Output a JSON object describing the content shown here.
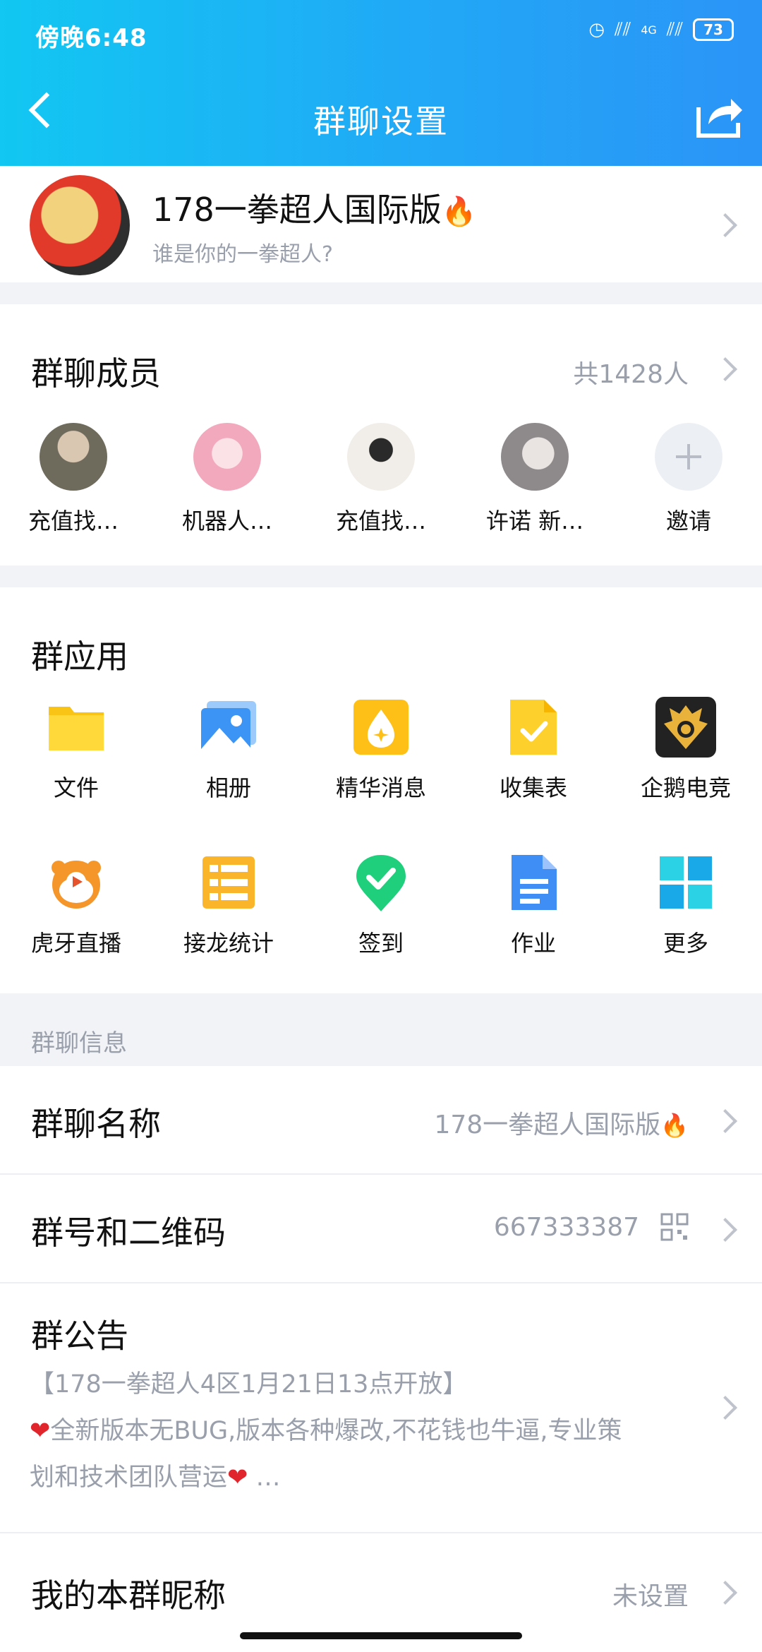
{
  "status_bar": {
    "time": "傍晚6:48",
    "network": "4G",
    "battery": "73"
  },
  "header": {
    "title": "群聊设置"
  },
  "group": {
    "name": "178一拳超人国际版",
    "name_emoji": "🔥",
    "description": "谁是你的一拳超人?"
  },
  "members": {
    "title": "群聊成员",
    "count": "共1428人",
    "items": [
      {
        "name": "充值找…"
      },
      {
        "name": "机器人…"
      },
      {
        "name": "充值找…"
      },
      {
        "name": "许诺 新…"
      },
      {
        "name": "邀请"
      }
    ]
  },
  "apps": {
    "title": "群应用",
    "items": [
      {
        "label": "文件",
        "icon": "folder-icon"
      },
      {
        "label": "相册",
        "icon": "photo-album-icon"
      },
      {
        "label": "精华消息",
        "icon": "essence-icon"
      },
      {
        "label": "收集表",
        "icon": "form-icon"
      },
      {
        "label": "企鹅电竞",
        "icon": "esports-icon"
      },
      {
        "label": "虎牙直播",
        "icon": "huya-icon"
      },
      {
        "label": "接龙统计",
        "icon": "relay-icon"
      },
      {
        "label": "签到",
        "icon": "checkin-icon"
      },
      {
        "label": "作业",
        "icon": "homework-icon"
      },
      {
        "label": "更多",
        "icon": "more-grid-icon"
      }
    ]
  },
  "info": {
    "section_label": "群聊信息",
    "group_name_label": "群聊名称",
    "group_name_value": "178一拳超人国际版",
    "group_id_label": "群号和二维码",
    "group_id_value": "667333387",
    "notice_label": "群公告",
    "notice_line1": "【178一拳超人4区1月21日13点开放】",
    "notice_line2": "全新版本无BUG,版本各种爆改,不花钱也牛逼,专业策",
    "notice_line3": "划和技术团队营运",
    "notice_more": "…",
    "nickname_label": "我的本群昵称",
    "nickname_value": "未设置"
  },
  "colors": {
    "header_start": "#12c7f2",
    "header_end": "#2b94f7",
    "secondary_text": "#9aa0ab"
  }
}
